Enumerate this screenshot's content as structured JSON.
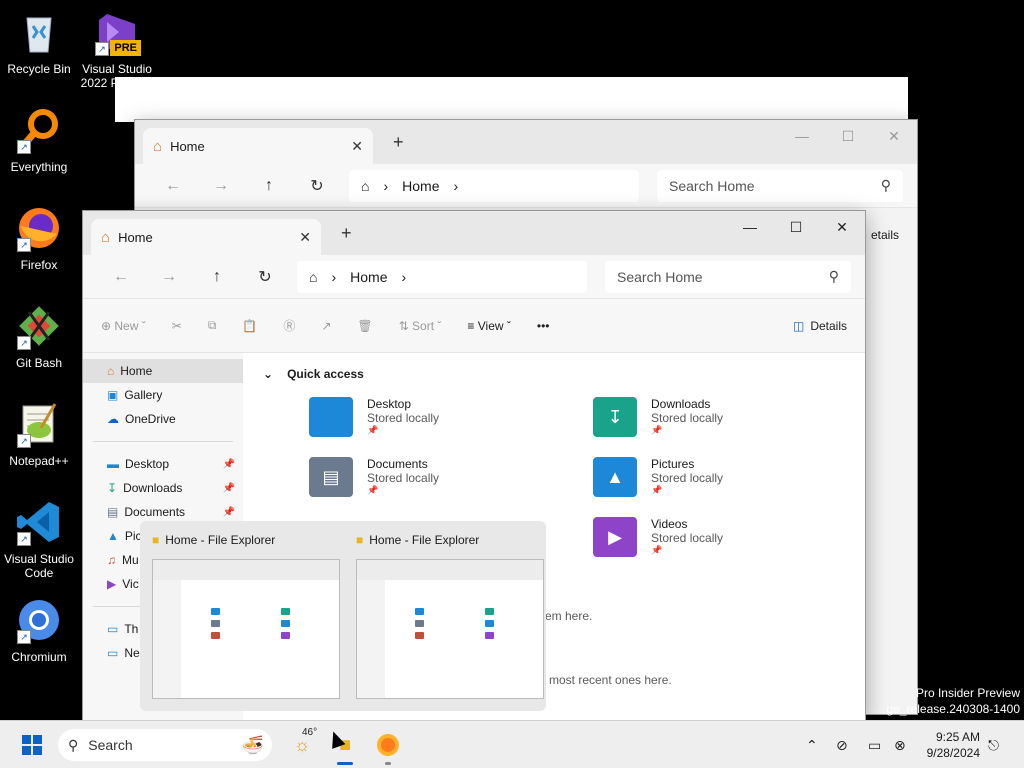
{
  "desktop": {
    "icons": [
      {
        "label": "Recycle Bin"
      },
      {
        "label": "Visual Studio 2022 Preview"
      },
      {
        "label": "Everything"
      },
      {
        "label": "Firefox"
      },
      {
        "label": "Git Bash"
      },
      {
        "label": "Notepad++"
      },
      {
        "label": "Visual Studio Code"
      },
      {
        "label": "Chromium"
      }
    ],
    "vs_badge": "PRE",
    "watermark_line1": "Pro Insider Preview",
    "watermark_line2": "ge_release.240308-1400"
  },
  "back_window": {
    "tab_title": "Home",
    "address": "Home",
    "search_placeholder": "Search Home",
    "details_fragment": "etails"
  },
  "front_window": {
    "tab_title": "Home",
    "address": "Home",
    "search_placeholder": "Search Home",
    "commands": {
      "new_label": "New",
      "sort_label": "Sort",
      "view_label": "View",
      "more_label": "•••",
      "details_label": "Details"
    },
    "nav": {
      "top": [
        {
          "label": "Home",
          "icon": "home-icon"
        },
        {
          "label": "Gallery",
          "icon": "gallery-icon"
        },
        {
          "label": "OneDrive",
          "icon": "onedrive-icon"
        }
      ],
      "pinned": [
        {
          "label": "Desktop"
        },
        {
          "label": "Downloads"
        },
        {
          "label": "Documents"
        },
        {
          "label": "Pic"
        },
        {
          "label": "Mu"
        },
        {
          "label": "Vic"
        }
      ],
      "bottom": [
        {
          "label": "Th"
        },
        {
          "label": "Ne"
        }
      ]
    },
    "quick_access_label": "Quick access",
    "folders": [
      {
        "name": "Desktop",
        "status": "Stored locally",
        "color": "#1e88d8"
      },
      {
        "name": "Downloads",
        "status": "Stored locally",
        "color": "#19a38a"
      },
      {
        "name": "Documents",
        "status": "Stored locally",
        "color": "#6b7a8f"
      },
      {
        "name": "Pictures",
        "status": "Stored locally",
        "color": "#1e88d8"
      },
      {
        "name": "Videos",
        "status": "Stored locally",
        "color": "#8e44c8"
      }
    ],
    "partial_text_1": "em here.",
    "partial_text_2": "most recent ones here."
  },
  "thumbnails": [
    {
      "title": "Home - File Explorer"
    },
    {
      "title": "Home - File Explorer"
    }
  ],
  "taskbar": {
    "search_label": "Search",
    "weather_temp": "46°",
    "time": "9:25 AM",
    "date": "9/28/2024"
  }
}
